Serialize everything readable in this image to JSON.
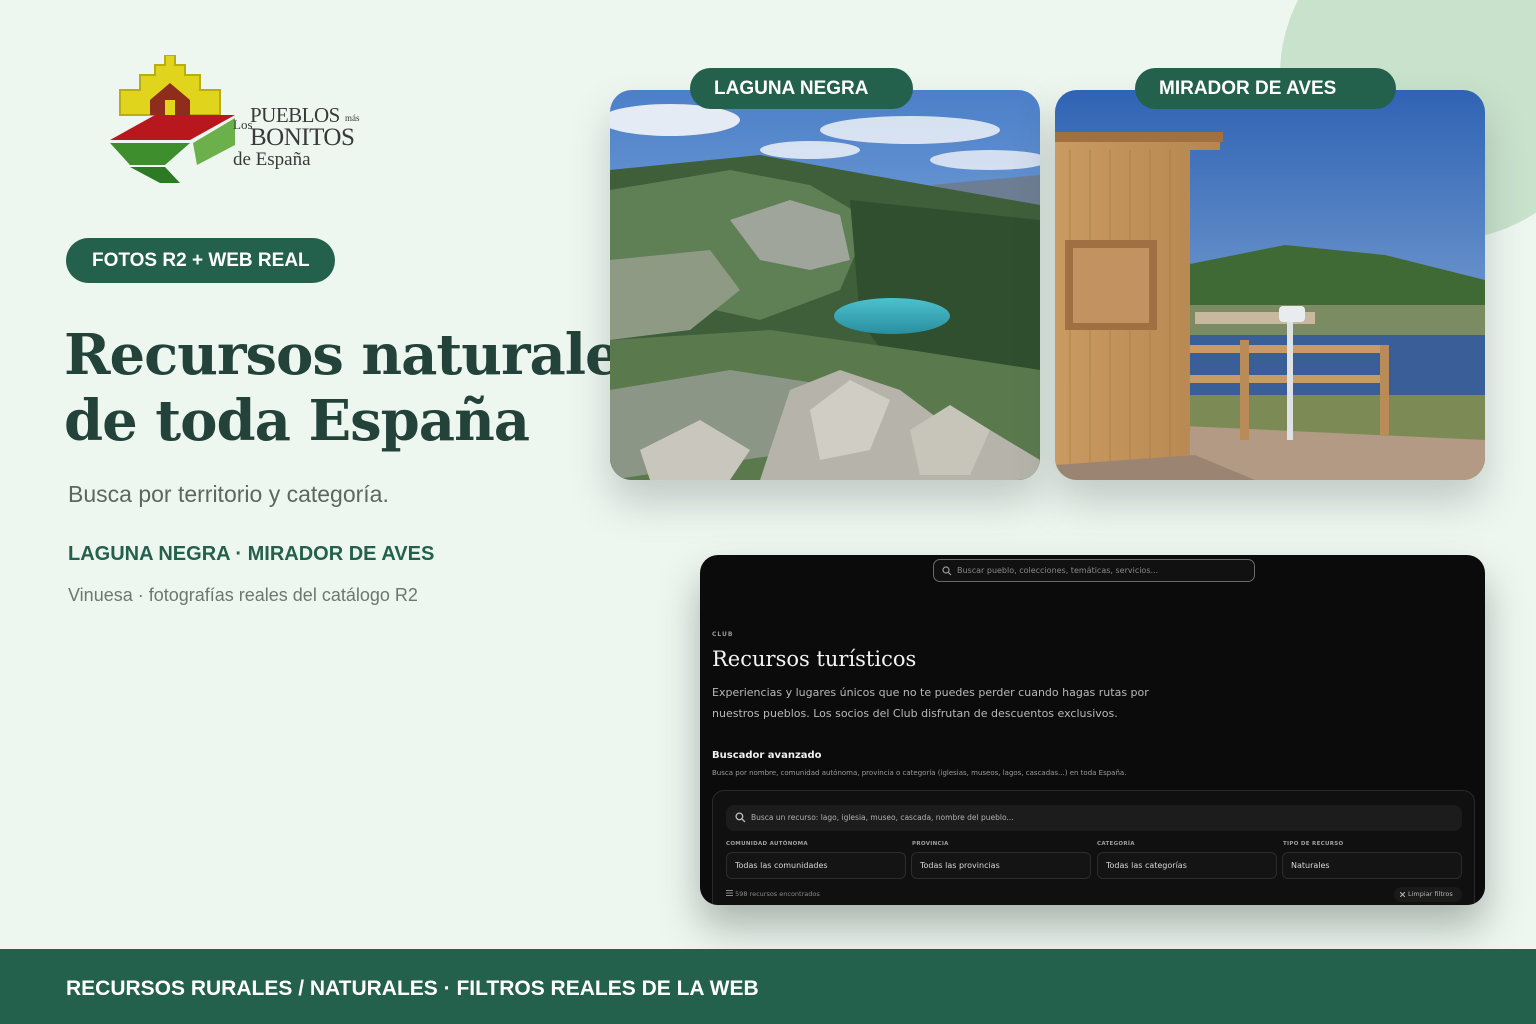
{
  "logo": {
    "los": "Los",
    "pueblos": "PUEBLOS",
    "mas": "más",
    "bonitos": "BONITOS",
    "espana": "de España"
  },
  "badge": "FOTOS R2 + WEB REAL",
  "title_line1": "Recursos naturales",
  "title_line2": "de toda España",
  "subtitle": "Busca por territorio y categoría.",
  "highlight": "LAGUNA NEGRA · MIRADOR DE AVES",
  "caption": "Vinuesa · fotografías reales del catálogo R2",
  "cards": [
    {
      "label": "LAGUNA NEGRA"
    },
    {
      "label": "MIRADOR DE AVES"
    }
  ],
  "screenshot": {
    "search_placeholder": "Buscar pueblo, colecciones, temáticas, servicios...",
    "kicker": "CLUB",
    "title": "Recursos turísticos",
    "description": "Experiencias y lugares únicos que no te puedes perder cuando hagas rutas por nuestros pueblos. Los socios del Club disfrutan de descuentos exclusivos.",
    "advanced_heading": "Buscador avanzado",
    "advanced_sub": "Busca por nombre, comunidad autónoma, provincia o categoría (iglesias, museos, lagos, cascadas...) en toda España.",
    "resource_placeholder": "Busca un recurso: lago, iglesia, museo, cascada, nombre del pueblo...",
    "filters": [
      {
        "label": "COMUNIDAD AUTÓNOMA",
        "value": "Todas las comunidades"
      },
      {
        "label": "PROVINCIA",
        "value": "Todas las provincias"
      },
      {
        "label": "CATEGORÍA",
        "value": "Todas las categorías"
      },
      {
        "label": "TIPO DE RECURSO",
        "value": "Naturales"
      }
    ],
    "count": "598 recursos encontrados",
    "clear": "Limpiar filtros"
  },
  "footer": "RECURSOS RURALES / NATURALES · FILTROS REALES DE LA WEB",
  "colors": {
    "brand_green": "#24614c",
    "background": "#eef6f0",
    "title": "#23423a"
  },
  "icons": [
    "search-icon",
    "list-icon",
    "close-icon"
  ]
}
